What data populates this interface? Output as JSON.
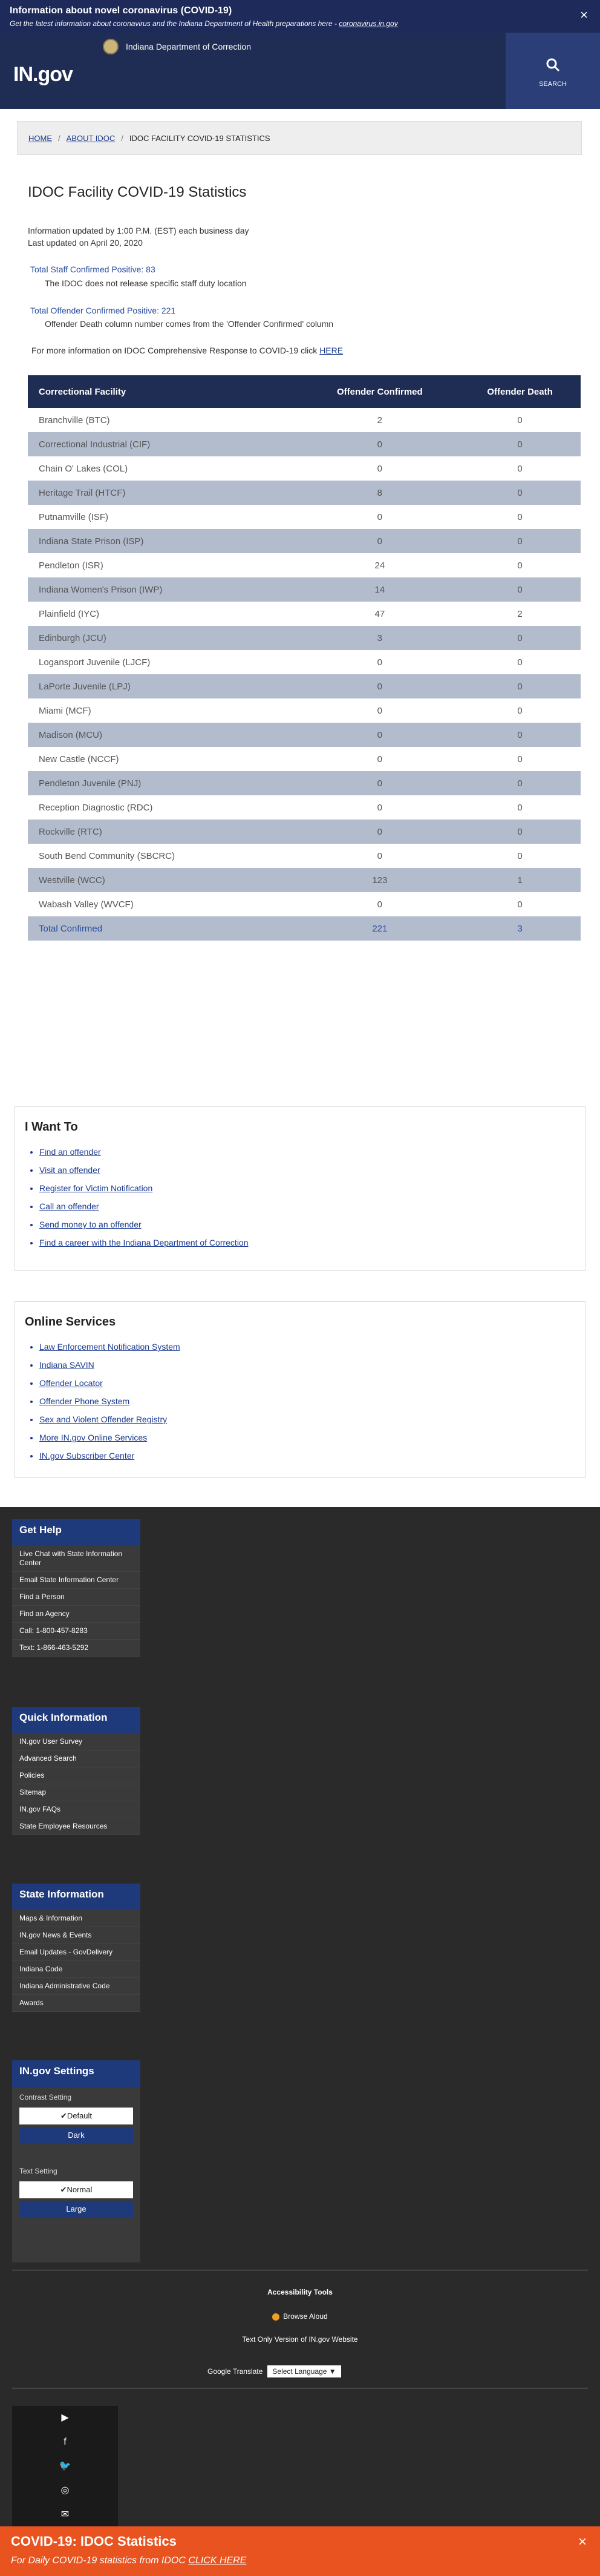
{
  "alert": {
    "title": "Information about novel coronavirus (COVID-19)",
    "text": "Get the latest information about coronavirus and the Indiana Department of Health preparations here - ",
    "link": "coronavirus.in.gov",
    "close": "×"
  },
  "header": {
    "logo": "IN.gov",
    "agency": "Indiana Department of Correction",
    "search_label": "SEARCH"
  },
  "breadcrumb": {
    "home": "HOME",
    "about": "ABOUT IDOC",
    "current": "IDOC FACILITY COVID-19 STATISTICS",
    "sep": "/"
  },
  "page": {
    "title": "IDOC Facility COVID-19 Statistics",
    "updated1": "Information updated by 1:00 P.M. (EST) each business day",
    "updated2": "Last updated on April 20, 2020",
    "staff_positive": "Total Staff Confirmed Positive: 83",
    "staff_note": "The IDOC does not release specific staff duty location",
    "offender_positive": "Total Offender Confirmed Positive: 221",
    "offender_note": "Offender Death column number comes from the 'Offender Confirmed' column",
    "more_text": "For more information on IDOC Comprehensive Response to COVID-19 click ",
    "more_link": "HERE"
  },
  "table": {
    "headers": [
      "Correctional Facility",
      "Offender Confirmed",
      "Offender Death"
    ],
    "rows": [
      [
        "Branchville (BTC)",
        "2",
        "0"
      ],
      [
        "Correctional Industrial (CIF)",
        "0",
        "0"
      ],
      [
        "Chain O' Lakes (COL)",
        "0",
        "0"
      ],
      [
        "Heritage Trail (HTCF)",
        "8",
        "0"
      ],
      [
        "Putnamville (ISF)",
        "0",
        "0"
      ],
      [
        "Indiana State Prison (ISP)",
        "0",
        "0"
      ],
      [
        "Pendleton (ISR)",
        "24",
        "0"
      ],
      [
        "Indiana Women's Prison (IWP)",
        "14",
        "0"
      ],
      [
        "Plainfield (IYC)",
        "47",
        "2"
      ],
      [
        "Edinburgh (JCU)",
        "3",
        "0"
      ],
      [
        "Logansport Juvenile (LJCF)",
        "0",
        "0"
      ],
      [
        "LaPorte Juvenile (LPJ)",
        "0",
        "0"
      ],
      [
        "Miami (MCF)",
        "0",
        "0"
      ],
      [
        "Madison (MCU)",
        "0",
        "0"
      ],
      [
        "New Castle (NCCF)",
        "0",
        "0"
      ],
      [
        "Pendleton Juvenile (PNJ)",
        "0",
        "0"
      ],
      [
        "Reception Diagnostic (RDC)",
        "0",
        "0"
      ],
      [
        "Rockville (RTC)",
        "0",
        "0"
      ],
      [
        "South Bend Community (SBCRC)",
        "0",
        "0"
      ],
      [
        "Westville (WCC)",
        "123",
        "1"
      ],
      [
        "Wabash Valley (WVCF)",
        "0",
        "0"
      ]
    ],
    "total": [
      "Total Confirmed",
      "221",
      "3"
    ]
  },
  "iwant": {
    "title": "I Want To",
    "links": [
      "Find an offender",
      "Visit an offender",
      "Register for Victim Notification",
      "Call an offender",
      "Send money to an offender",
      "Find a career with the Indiana Department of Correction"
    ]
  },
  "online": {
    "title": "Online Services",
    "links": [
      "Law Enforcement Notification System",
      "Indiana SAVIN",
      "Offender Locator",
      "Offender Phone System",
      "Sex and Violent Offender Registry",
      "More IN.gov Online Services",
      "IN.gov Subscriber Center"
    ]
  },
  "footer": {
    "get_help": {
      "title": "Get Help",
      "items": [
        "Live Chat with State Information Center",
        "Email State Information Center",
        "Find a Person",
        "Find an Agency",
        "Call: 1-800-457-8283",
        "Text: 1-866-463-5292"
      ]
    },
    "quick_info": {
      "title": "Quick Information",
      "items": [
        "IN.gov User Survey",
        "Advanced Search",
        "Policies",
        "Sitemap",
        "IN.gov FAQs",
        "State Employee Resources"
      ]
    },
    "state_info": {
      "title": "State Information",
      "items": [
        "Maps & Information",
        "IN.gov News & Events",
        "Email Updates - GovDelivery",
        "Indiana Code",
        "Indiana Administrative Code",
        "Awards"
      ]
    },
    "settings": {
      "title": "IN.gov Settings",
      "contrast_label": "Contrast Setting",
      "contrast_default": "✔Default",
      "contrast_dark": "Dark",
      "text_label": "Text Setting",
      "text_normal": "✔Normal",
      "text_large": "Large"
    },
    "accessibility": {
      "title": "Accessibility Tools",
      "browse": "Browse Aloud",
      "text_only": "Text Only Version of IN.gov Website",
      "translate_label": "Google Translate",
      "translate_select": "Select Language ▼"
    },
    "social": [
      "▶",
      "f",
      "🐦",
      "◎",
      "✉"
    ]
  },
  "bottom_banner": {
    "title": "COVID-19: IDOC Statistics",
    "text": "For Daily COVID-19 statistics from IDOC ",
    "link": "CLICK HERE",
    "close": "×"
  },
  "colors": {
    "navy": "#1f2d55",
    "row_alt": "#b3bccc",
    "link": "#1a3a8f",
    "banner_orange": "#e8531f"
  }
}
